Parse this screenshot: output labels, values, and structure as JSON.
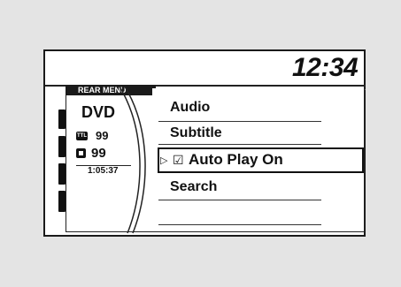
{
  "clock": "12:34",
  "panel_title": "REAR MENU",
  "source": {
    "label": "DVD",
    "title_badge": "TTL",
    "title_number": "99",
    "chapter_number": "99",
    "elapsed": "1:05:37"
  },
  "menu": {
    "items": [
      {
        "label": "Audio"
      },
      {
        "label": "Subtitle"
      },
      {
        "label": "Auto Play On",
        "selected": true,
        "checked": true
      },
      {
        "label": "Search"
      }
    ]
  },
  "icons": {
    "selection_arrow": "▷",
    "checkbox": "☑"
  }
}
